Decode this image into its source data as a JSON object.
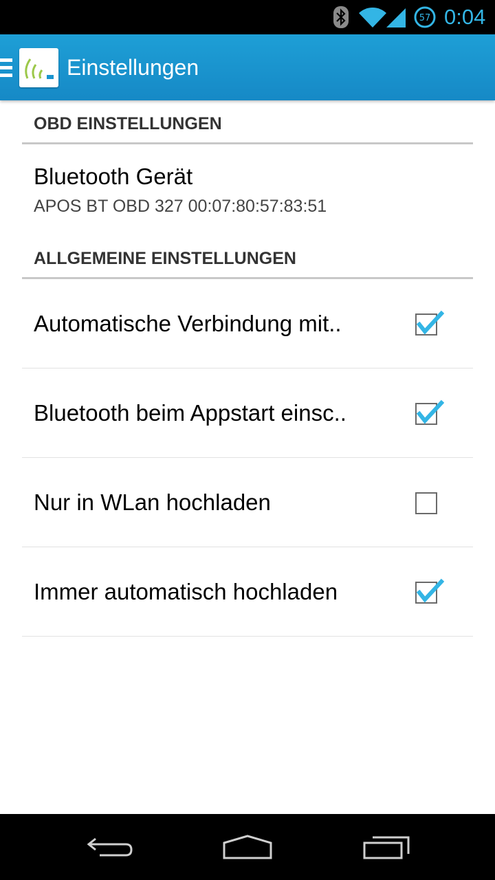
{
  "status_bar": {
    "time": "0:04",
    "battery_level": "57",
    "icons": [
      "bluetooth-icon",
      "wifi-icon",
      "signal-icon",
      "battery-icon"
    ],
    "accent": "#33b5e5"
  },
  "action_bar": {
    "title": "Einstellungen",
    "color": "#1a94cf"
  },
  "sections": [
    {
      "header": "OBD EINSTELLUNGEN",
      "items": [
        {
          "title": "Bluetooth Gerät",
          "summary": "APOS BT OBD 327 00:07:80:57:83:51"
        }
      ]
    },
    {
      "header": "ALLGEMEINE EINSTELLUNGEN",
      "items": [
        {
          "title": "Automatische Verbindung mit..",
          "checked": true
        },
        {
          "title": "Bluetooth beim Appstart einsc..",
          "checked": true
        },
        {
          "title": "Nur in WLan hochladen",
          "checked": false
        },
        {
          "title": "Immer automatisch hochladen",
          "checked": true
        }
      ]
    }
  ],
  "nav_bar": {
    "buttons": [
      "back-icon",
      "home-icon",
      "recent-apps-icon"
    ]
  }
}
